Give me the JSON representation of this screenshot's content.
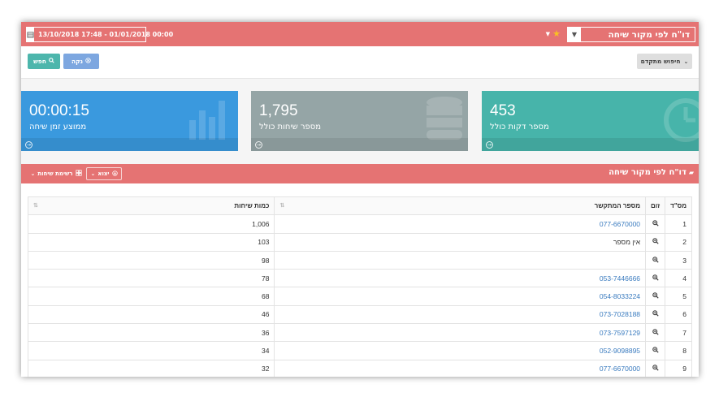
{
  "topbar": {
    "report_name": "דו\"ח לפי מקור שיחה",
    "date_range": "13/10/2018 17:48 - 01/01/2018 00:00"
  },
  "search": {
    "search_label": "חפש",
    "clear_label": "נקה",
    "advanced_label": "חיפוש מתקדם"
  },
  "cards": {
    "avg": {
      "value": "00:00:15",
      "label": "ממוצע זמן שיחה",
      "color": "#3a99de"
    },
    "calls": {
      "value": "1,795",
      "label": "מספר שיחות כולל",
      "color": "#95a5a6"
    },
    "minutes": {
      "value": "453",
      "label": "מספר דקות כולל",
      "color": "#47b4aa"
    }
  },
  "report": {
    "title": "דו\"ח לפי מקור שיחה",
    "export_label": "יצוא",
    "list_label": "רשימת שיחות"
  },
  "table": {
    "headers": {
      "num": "מס\"ד",
      "zoom": "זום",
      "phone": "מספר המתקשר",
      "count": "כמות שיחות"
    },
    "rows": [
      {
        "num": "1",
        "phone": "077-6670000",
        "count": "1,006",
        "link": true
      },
      {
        "num": "2",
        "phone": "אין מספר",
        "count": "103",
        "link": false
      },
      {
        "num": "3",
        "phone": "",
        "count": "98",
        "link": false
      },
      {
        "num": "4",
        "phone": "053-7446666",
        "count": "78",
        "link": true
      },
      {
        "num": "5",
        "phone": "054-8033224",
        "count": "68",
        "link": true
      },
      {
        "num": "6",
        "phone": "073-7028188",
        "count": "46",
        "link": true
      },
      {
        "num": "7",
        "phone": "073-7597129",
        "count": "36",
        "link": true
      },
      {
        "num": "8",
        "phone": "052-9098895",
        "count": "34",
        "link": true
      },
      {
        "num": "9",
        "phone": "077-6670000",
        "count": "32",
        "link": true
      }
    ]
  },
  "colors": {
    "header_red": "#e57373",
    "link_blue": "#3a7bbf",
    "star": "#f9c022"
  }
}
